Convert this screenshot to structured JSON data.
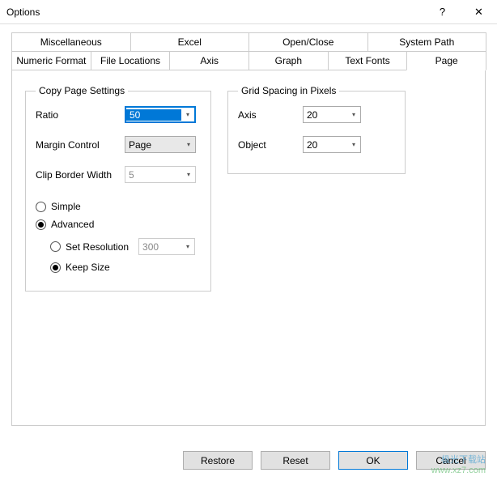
{
  "window": {
    "title": "Options",
    "help": "?",
    "close": "✕"
  },
  "tabs": {
    "row1": [
      "Miscellaneous",
      "Excel",
      "Open/Close",
      "System Path"
    ],
    "row2": [
      "Numeric Format",
      "File Locations",
      "Axis",
      "Graph",
      "Text Fonts",
      "Page"
    ]
  },
  "copyPage": {
    "legend": "Copy Page Settings",
    "ratio_label": "Ratio",
    "ratio_value": "50",
    "margin_label": "Margin Control",
    "margin_value": "Page",
    "clip_label": "Clip Border Width",
    "clip_value": "5",
    "simple_label": "Simple",
    "advanced_label": "Advanced",
    "setres_label": "Set Resolution",
    "setres_value": "300",
    "keepsize_label": "Keep Size"
  },
  "gridSpacing": {
    "legend": "Grid Spacing in Pixels",
    "axis_label": "Axis",
    "axis_value": "20",
    "object_label": "Object",
    "object_value": "20"
  },
  "buttons": {
    "restore": "Restore",
    "reset": "Reset",
    "ok": "OK",
    "cancel": "Cancel"
  },
  "watermark": {
    "line1": "极光下载站",
    "line2": "www.xz7.com"
  }
}
